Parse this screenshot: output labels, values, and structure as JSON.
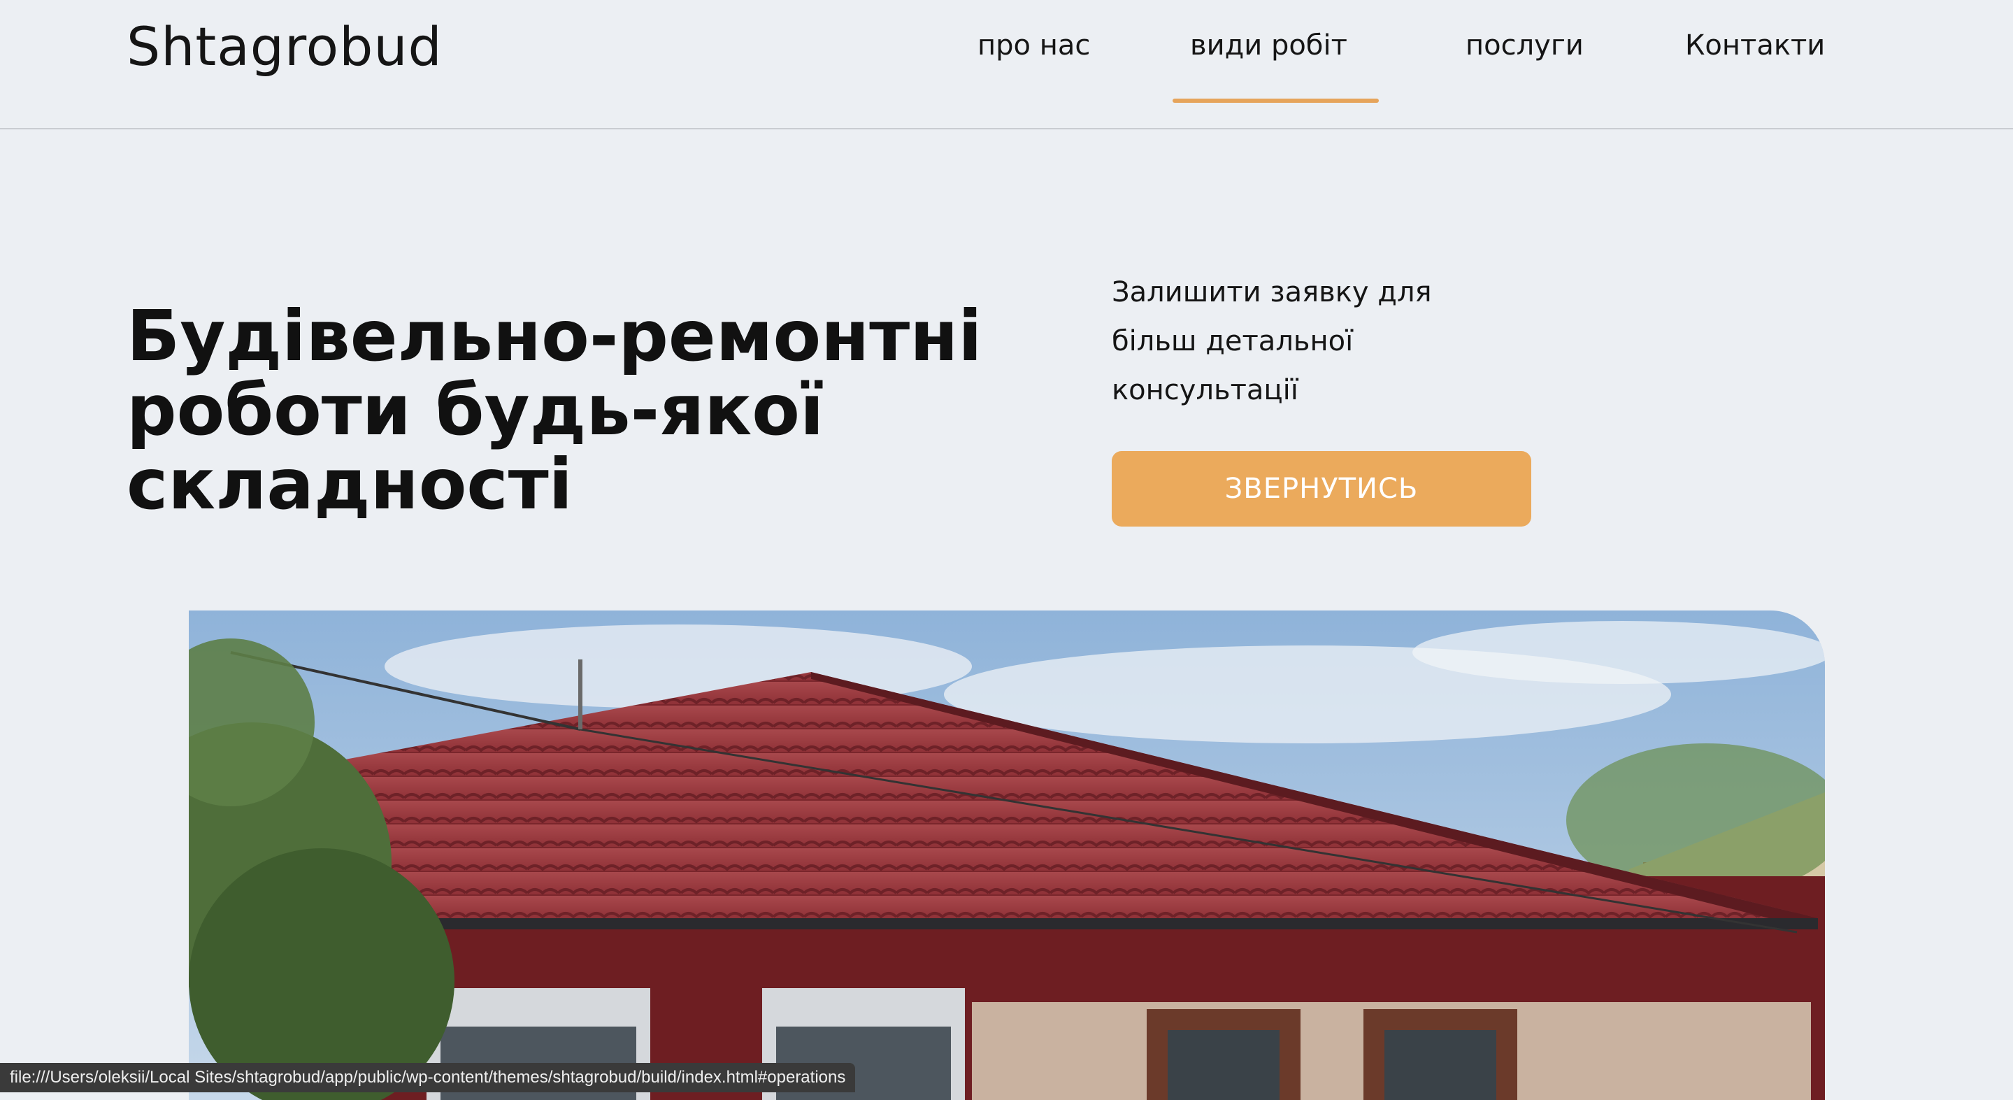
{
  "header": {
    "logo": "Shtagrobud",
    "nav": [
      {
        "label": "про нас",
        "active": false
      },
      {
        "label": "види робіт",
        "active": true
      },
      {
        "label": "послуги",
        "active": false
      },
      {
        "label": "Контакти",
        "active": false
      }
    ]
  },
  "hero": {
    "title": "Будівельно-ремонтні роботи будь-якої складності",
    "subtitle": "Залишити заявку для більш детальної консультації",
    "cta_label": "ЗВЕРНУТИСЬ"
  },
  "status_bar": {
    "url": "file:///Users/oleksii/Local Sites/shtagrobud/app/public/wp-content/themes/shtagrobud/build/index.html#operations"
  },
  "colors": {
    "background": "#eceff3",
    "accent": "#ebaa5c",
    "text": "#111111"
  }
}
